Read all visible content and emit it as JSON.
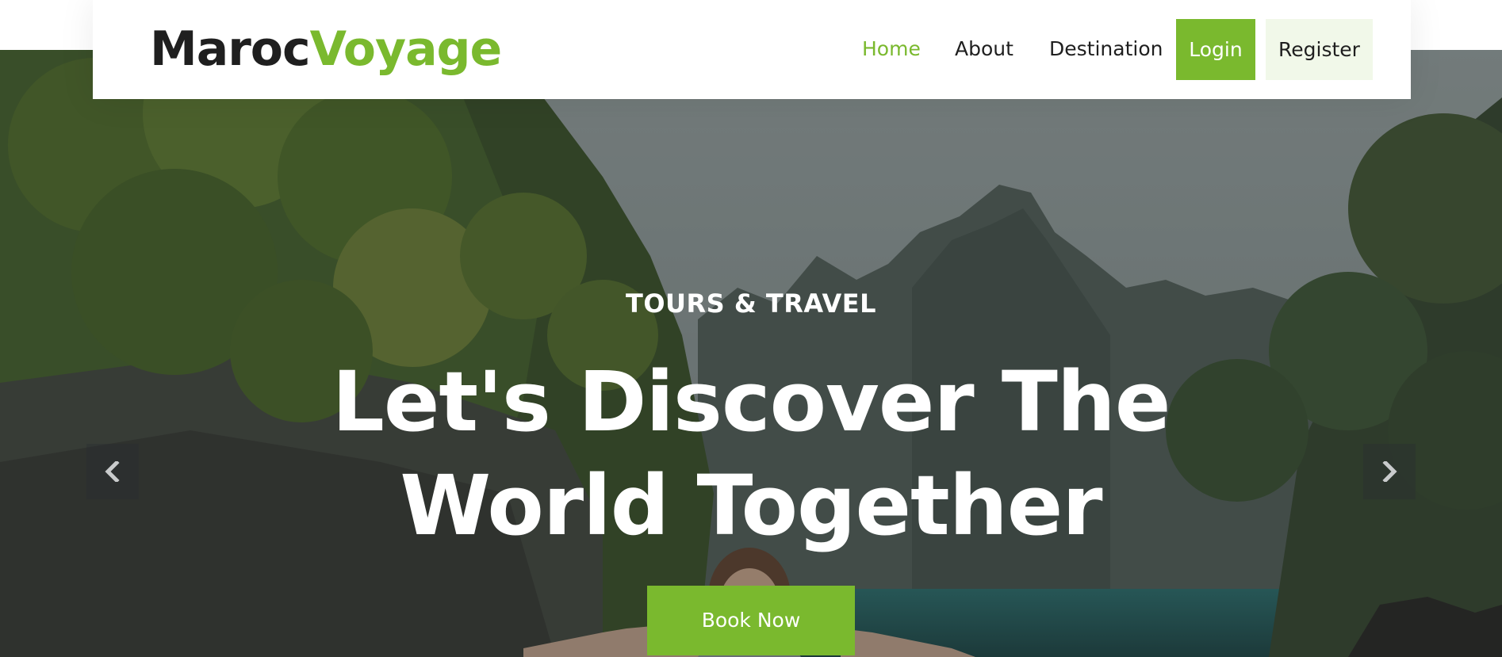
{
  "brand": {
    "part1": "Maroc",
    "part2": "Voyage"
  },
  "nav": {
    "home": "Home",
    "about": "About",
    "destination": "Destination",
    "login": "Login",
    "register": "Register"
  },
  "hero": {
    "eyebrow": "TOURS & TRAVEL",
    "headline_line1": "Let's Discover The",
    "headline_line2": "World Together",
    "cta": "Book Now",
    "prev_icon": "chevron-left-icon",
    "next_icon": "chevron-right-icon"
  },
  "colors": {
    "accent": "#7ab92e",
    "accent_light": "#f1f8e9",
    "text_dark": "#1f1f1f",
    "hero_overlay": "rgba(25,28,32,0.38)"
  }
}
